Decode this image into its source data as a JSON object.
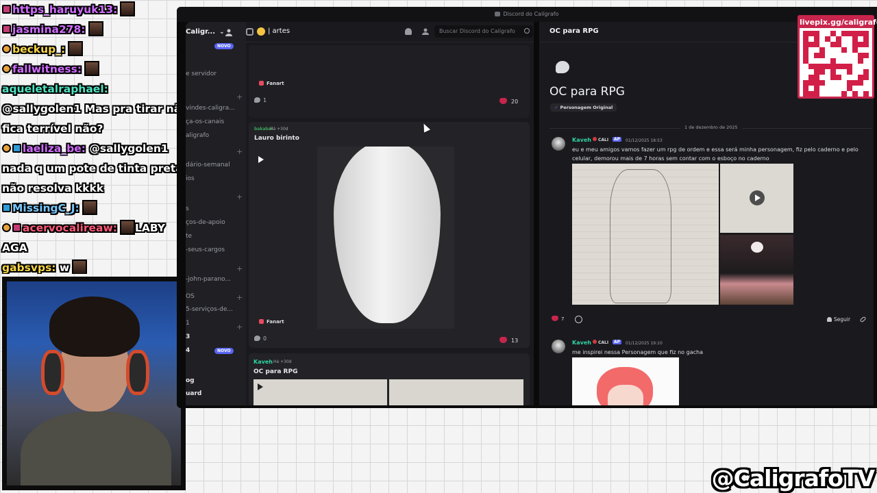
{
  "chat": {
    "lines": [
      {
        "user": "https_haruyuk13:",
        "text": ""
      },
      {
        "user": "jasmina278:",
        "text": ""
      },
      {
        "user": "beckup_:",
        "text": ""
      },
      {
        "user": "fallwitness:",
        "text": ""
      },
      {
        "user": "aqueletalraphael:",
        "text": ""
      },
      {
        "user": "",
        "text": "@sallygolen1 Mas pra tirar não"
      },
      {
        "user": "",
        "text": "fica terrível não?"
      },
      {
        "user": "laeliza_be:",
        "text": "@sallygolen1"
      },
      {
        "user": "",
        "text": "nada q um pote de tinta preta"
      },
      {
        "user": "",
        "text": "não resolva kkkk"
      },
      {
        "user": "MissingC_J:",
        "text": ""
      },
      {
        "user": "acervocalireaw:",
        "text": "LABY"
      },
      {
        "user": "",
        "text": "AGA"
      },
      {
        "user": "gabsvps:",
        "text": "w"
      }
    ]
  },
  "brand": {
    "handle": "@CaligrafoTV",
    "qr_url": "livepix.gg/caligrafo"
  },
  "window": {
    "title": "Discord do Calígrafo"
  },
  "sidebar": {
    "server_name": "Caligr...",
    "items": [
      {
        "label": "e servidor",
        "bold": false
      },
      {
        "label": "vindes-caligra...",
        "bold": false
      },
      {
        "label": "ça-os-canais",
        "bold": false
      },
      {
        "label": "aligrafo",
        "bold": false
      },
      {
        "label": "dário-semanal",
        "bold": false
      },
      {
        "label": "ios",
        "bold": false
      },
      {
        "label": "s",
        "bold": false
      },
      {
        "label": "ços-de-apoio",
        "bold": false
      },
      {
        "label": "te",
        "bold": false
      },
      {
        "label": "-seus-cargos",
        "bold": false
      },
      {
        "label": "-john-parano...",
        "bold": false
      },
      {
        "label": "OS",
        "bold": false
      },
      {
        "label": "5-serviços-de...",
        "bold": false
      },
      {
        "label": "1",
        "bold": false
      },
      {
        "label": "3",
        "bold": true
      },
      {
        "label": "4",
        "bold": true
      },
      {
        "label": "og",
        "bold": true
      },
      {
        "label": "uard",
        "bold": true
      }
    ],
    "new_badge": "NOVO"
  },
  "forum": {
    "channel": "| artes",
    "search_placeholder": "Buscar Discord do Calígrafo",
    "cards": [
      {
        "tag": "Fanart",
        "replies": "1",
        "reactions": "20"
      },
      {
        "author": "bakabai",
        "time": "Há +30d",
        "title": "Lauro birinto",
        "tag": "Fanart",
        "replies": "0",
        "reactions": "13"
      },
      {
        "author": "Kaveh",
        "time": "Há +30d",
        "title": "OC para RPG"
      }
    ]
  },
  "thread": {
    "header_title": "OC para RPG",
    "big_title": "OC para RPG",
    "tag": "Personagem Original",
    "date_divider": "1 de dezembro de 2025",
    "messages": [
      {
        "name": "Kaveh",
        "badge_cali": "CALI",
        "badge_ap": "AP",
        "time": "01/12/2025 18:53",
        "text": "eu e meu amigos vamos fazer um rpg de ordem e essa será minha personagem, fiz pelo caderno e pelo celular, demorou mais de 7 horas sem contar com o esboço no caderno",
        "reactions": "7",
        "follow": "Seguir"
      },
      {
        "name": "Kaveh",
        "badge_cali": "CALI",
        "badge_ap": "AP",
        "time": "01/12/2025 19:10",
        "text": "me inspirei nessa Personagem que fiz no gacha"
      }
    ]
  }
}
